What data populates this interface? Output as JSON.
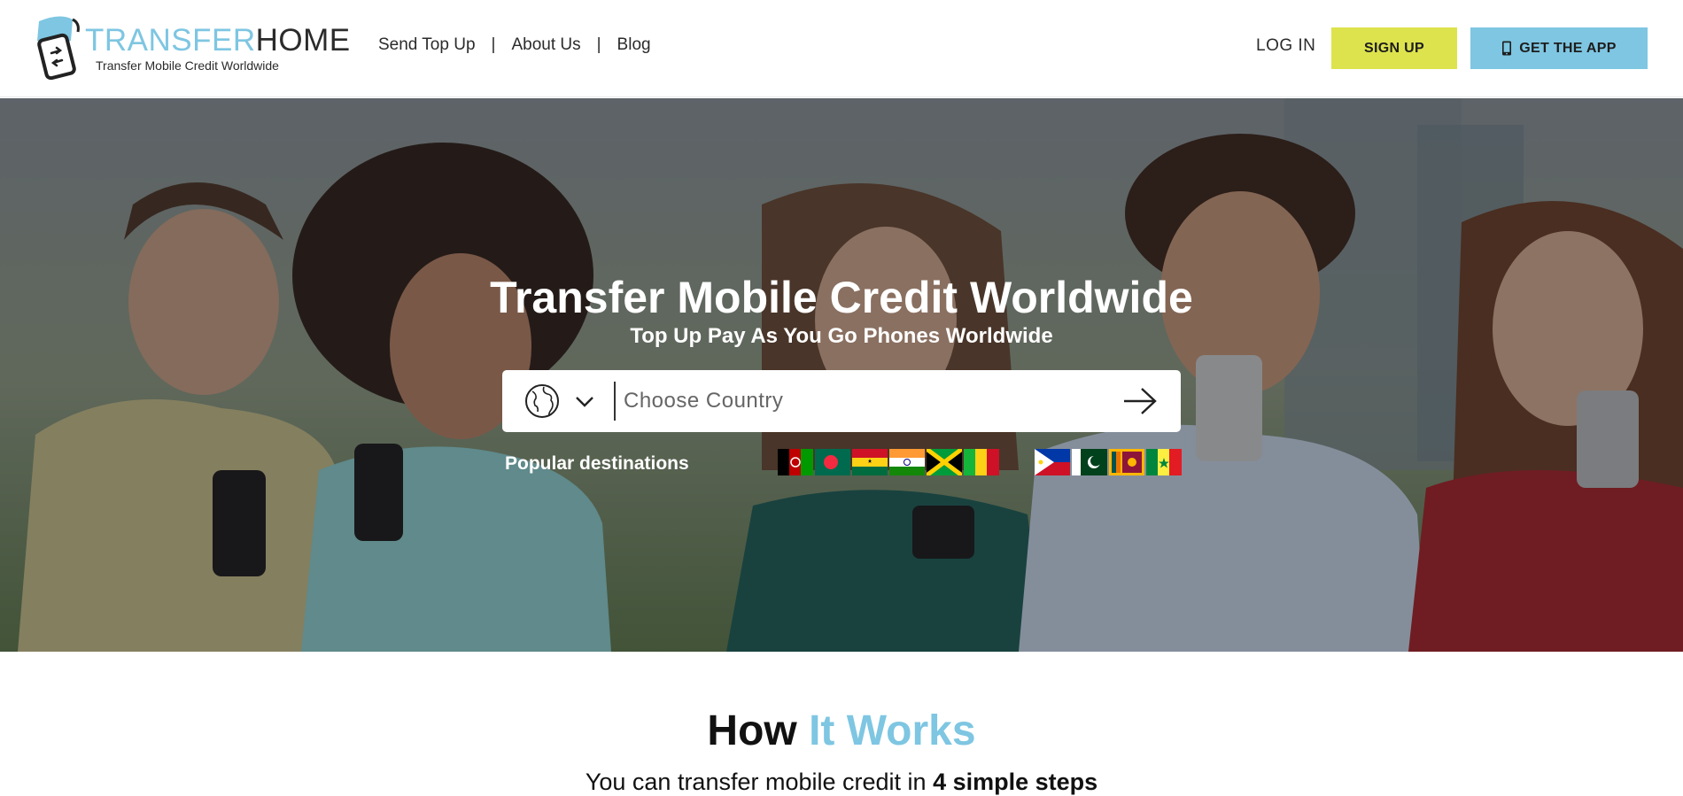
{
  "brand": {
    "name_part1": "TRANSFER",
    "name_part2": "HOME",
    "tagline": "Transfer Mobile Credit Worldwide",
    "accent_color": "#7ec6e2"
  },
  "nav": {
    "items": [
      {
        "label": "Send Top Up"
      },
      {
        "label": "About Us"
      },
      {
        "label": "Blog"
      }
    ],
    "separator": "|"
  },
  "header_actions": {
    "login_label": "LOG IN",
    "signup_label": "SIGN UP",
    "signup_color": "#dde34d",
    "app_label": "GET THE APP",
    "app_icon": "mobile-phone-icon",
    "app_color": "#7ec6e2"
  },
  "hero": {
    "title": "Transfer Mobile Credit Worldwide",
    "subtitle": "Top Up Pay As You Go Phones Worldwide",
    "search": {
      "placeholder": "Choose Country",
      "left_icon": "globe-icon",
      "dropdown_icon": "chevron-down-icon",
      "submit_icon": "arrow-right-icon"
    },
    "popular_label": "Popular destinations",
    "popular_flags_group1": [
      "Afghanistan",
      "Bangladesh",
      "Ghana",
      "India",
      "Jamaica",
      "Mali"
    ],
    "popular_flags_group2": [
      "Philippines",
      "Pakistan",
      "Sri Lanka",
      "Senegal"
    ]
  },
  "how_it_works": {
    "title_part1": "How ",
    "title_part2": "It Works",
    "subtitle_part1": "You can transfer mobile credit in ",
    "subtitle_part2": "4 simple steps"
  }
}
